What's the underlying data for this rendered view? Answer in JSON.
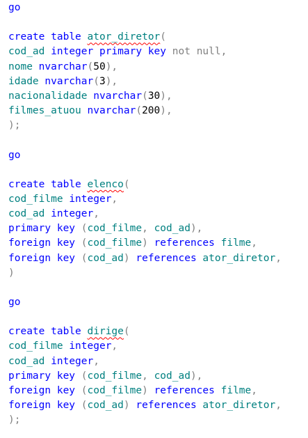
{
  "editor": {
    "colors": {
      "background": "#ffffff",
      "keyword": "#0000ff",
      "identifier": "#008080",
      "punctuation": "#808080",
      "number": "#000000",
      "error_squiggle": "#ff0000"
    },
    "lines": [
      [
        {
          "t": "go",
          "c": "kw"
        }
      ],
      [],
      [
        {
          "t": "create",
          "c": "kw"
        },
        {
          "t": " "
        },
        {
          "t": "table",
          "c": "kw"
        },
        {
          "t": " "
        },
        {
          "t": "ator_diretor",
          "c": "id",
          "squig": true
        },
        {
          "t": "(",
          "c": "gr"
        }
      ],
      [
        {
          "t": "cod_ad",
          "c": "id"
        },
        {
          "t": " "
        },
        {
          "t": "integer",
          "c": "ty"
        },
        {
          "t": " "
        },
        {
          "t": "primary",
          "c": "kw"
        },
        {
          "t": " "
        },
        {
          "t": "key",
          "c": "kw"
        },
        {
          "t": " "
        },
        {
          "t": "not",
          "c": "gr"
        },
        {
          "t": " "
        },
        {
          "t": "null",
          "c": "gr"
        },
        {
          "t": ",",
          "c": "gr"
        }
      ],
      [
        {
          "t": "nome",
          "c": "id"
        },
        {
          "t": " "
        },
        {
          "t": "nvarchar",
          "c": "ty"
        },
        {
          "t": "(",
          "c": "gr"
        },
        {
          "t": "50",
          "c": "nm"
        },
        {
          "t": "),",
          "c": "gr"
        }
      ],
      [
        {
          "t": "idade",
          "c": "id"
        },
        {
          "t": " "
        },
        {
          "t": "nvarchar",
          "c": "ty"
        },
        {
          "t": "(",
          "c": "gr"
        },
        {
          "t": "3",
          "c": "nm"
        },
        {
          "t": "),",
          "c": "gr"
        }
      ],
      [
        {
          "t": "nacionalidade",
          "c": "id"
        },
        {
          "t": " "
        },
        {
          "t": "nvarchar",
          "c": "ty"
        },
        {
          "t": "(",
          "c": "gr"
        },
        {
          "t": "30",
          "c": "nm"
        },
        {
          "t": "),",
          "c": "gr"
        }
      ],
      [
        {
          "t": "filmes_atuou",
          "c": "id"
        },
        {
          "t": " "
        },
        {
          "t": "nvarchar",
          "c": "ty"
        },
        {
          "t": "(",
          "c": "gr"
        },
        {
          "t": "200",
          "c": "nm"
        },
        {
          "t": "),",
          "c": "gr"
        }
      ],
      [
        {
          "t": ");",
          "c": "gr"
        }
      ],
      [],
      [
        {
          "t": "go",
          "c": "kw"
        }
      ],
      [],
      [
        {
          "t": "create",
          "c": "kw"
        },
        {
          "t": " "
        },
        {
          "t": "table",
          "c": "kw"
        },
        {
          "t": " "
        },
        {
          "t": "elenco",
          "c": "id",
          "squig": true
        },
        {
          "t": "(",
          "c": "gr"
        }
      ],
      [
        {
          "t": "cod_filme",
          "c": "id"
        },
        {
          "t": " "
        },
        {
          "t": "integer",
          "c": "ty"
        },
        {
          "t": ",",
          "c": "gr"
        }
      ],
      [
        {
          "t": "cod_ad",
          "c": "id"
        },
        {
          "t": " "
        },
        {
          "t": "integer",
          "c": "ty"
        },
        {
          "t": ",",
          "c": "gr"
        }
      ],
      [
        {
          "t": "primary",
          "c": "kw"
        },
        {
          "t": " "
        },
        {
          "t": "key",
          "c": "kw"
        },
        {
          "t": " "
        },
        {
          "t": "(",
          "c": "gr"
        },
        {
          "t": "cod_filme",
          "c": "id"
        },
        {
          "t": ",",
          "c": "gr"
        },
        {
          "t": " "
        },
        {
          "t": "cod_ad",
          "c": "id"
        },
        {
          "t": "),",
          "c": "gr"
        }
      ],
      [
        {
          "t": "foreign",
          "c": "kw"
        },
        {
          "t": " "
        },
        {
          "t": "key",
          "c": "kw"
        },
        {
          "t": " "
        },
        {
          "t": "(",
          "c": "gr"
        },
        {
          "t": "cod_filme",
          "c": "id"
        },
        {
          "t": ")",
          "c": "gr"
        },
        {
          "t": " "
        },
        {
          "t": "references",
          "c": "kw"
        },
        {
          "t": " "
        },
        {
          "t": "filme",
          "c": "id"
        },
        {
          "t": ",",
          "c": "gr"
        }
      ],
      [
        {
          "t": "foreign",
          "c": "kw"
        },
        {
          "t": " "
        },
        {
          "t": "key",
          "c": "kw"
        },
        {
          "t": " "
        },
        {
          "t": "(",
          "c": "gr"
        },
        {
          "t": "cod_ad",
          "c": "id"
        },
        {
          "t": ")",
          "c": "gr"
        },
        {
          "t": " "
        },
        {
          "t": "references",
          "c": "kw"
        },
        {
          "t": " "
        },
        {
          "t": "ator_diretor",
          "c": "id"
        },
        {
          "t": ",",
          "c": "gr"
        }
      ],
      [
        {
          "t": ")",
          "c": "gr"
        }
      ],
      [],
      [
        {
          "t": "go",
          "c": "kw"
        }
      ],
      [],
      [
        {
          "t": "create",
          "c": "kw"
        },
        {
          "t": " "
        },
        {
          "t": "table",
          "c": "kw"
        },
        {
          "t": " "
        },
        {
          "t": "dirige",
          "c": "id",
          "squig": true
        },
        {
          "t": "(",
          "c": "gr"
        }
      ],
      [
        {
          "t": "cod_filme",
          "c": "id"
        },
        {
          "t": " "
        },
        {
          "t": "integer",
          "c": "ty"
        },
        {
          "t": ",",
          "c": "gr"
        }
      ],
      [
        {
          "t": "cod_ad",
          "c": "id"
        },
        {
          "t": " "
        },
        {
          "t": "integer",
          "c": "ty"
        },
        {
          "t": ",",
          "c": "gr"
        }
      ],
      [
        {
          "t": "primary",
          "c": "kw"
        },
        {
          "t": " "
        },
        {
          "t": "key",
          "c": "kw"
        },
        {
          "t": " "
        },
        {
          "t": "(",
          "c": "gr"
        },
        {
          "t": "cod_filme",
          "c": "id"
        },
        {
          "t": ",",
          "c": "gr"
        },
        {
          "t": " "
        },
        {
          "t": "cod_ad",
          "c": "id"
        },
        {
          "t": "),",
          "c": "gr"
        }
      ],
      [
        {
          "t": "foreign",
          "c": "kw"
        },
        {
          "t": " "
        },
        {
          "t": "key",
          "c": "kw"
        },
        {
          "t": " "
        },
        {
          "t": "(",
          "c": "gr"
        },
        {
          "t": "cod_filme",
          "c": "id"
        },
        {
          "t": ")",
          "c": "gr"
        },
        {
          "t": " "
        },
        {
          "t": "references",
          "c": "kw"
        },
        {
          "t": " "
        },
        {
          "t": "filme",
          "c": "id"
        },
        {
          "t": ",",
          "c": "gr"
        }
      ],
      [
        {
          "t": "foreign",
          "c": "kw"
        },
        {
          "t": " "
        },
        {
          "t": "key",
          "c": "kw"
        },
        {
          "t": " "
        },
        {
          "t": "(",
          "c": "gr"
        },
        {
          "t": "cod_ad",
          "c": "id"
        },
        {
          "t": ")",
          "c": "gr"
        },
        {
          "t": " "
        },
        {
          "t": "references",
          "c": "kw"
        },
        {
          "t": " "
        },
        {
          "t": "ator_diretor",
          "c": "id"
        },
        {
          "t": ",",
          "c": "gr"
        }
      ],
      [
        {
          "t": ");",
          "c": "gr"
        }
      ]
    ]
  }
}
